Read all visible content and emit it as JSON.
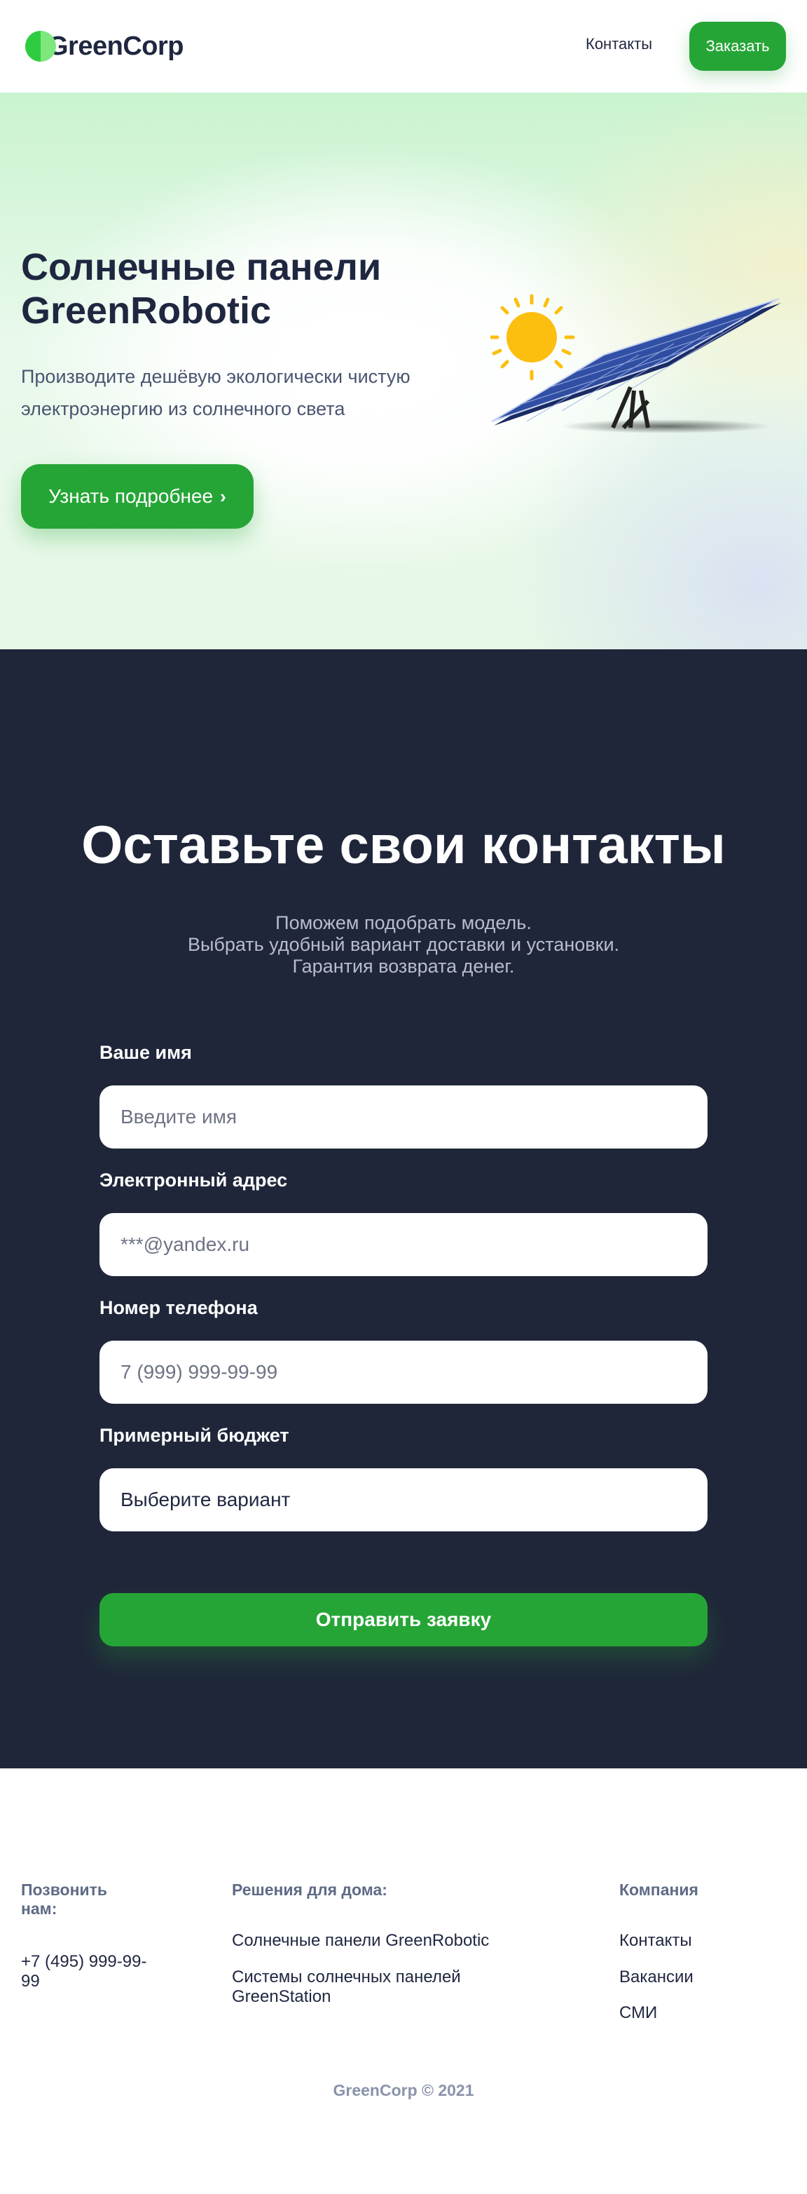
{
  "header": {
    "logo_text": "GreenCorp",
    "nav": {
      "contacts": "Контакты"
    },
    "order_button": "Заказать"
  },
  "hero": {
    "title_line1": "Солнечные панели",
    "title_line2": "GreenRobotic",
    "subtitle_line1": "Производите дешёвую экологически чистую",
    "subtitle_line2": "электроэнергию из солнечного света",
    "more_button": "Узнать подробнее",
    "more_button_icon": "chevron-right-icon"
  },
  "contact": {
    "title": "Оставьте свои контакты",
    "subtitle_lines": [
      "Поможем подобрать модель.",
      "Выбрать удобный вариант доставки и установки.",
      "Гарантия возврата денег."
    ],
    "fields": {
      "name": {
        "label": "Ваше имя",
        "placeholder": "Введите имя"
      },
      "email": {
        "label": "Электронный адрес",
        "placeholder": "***@yandex.ru"
      },
      "phone": {
        "label": "Номер телефона",
        "placeholder": "7 (999) 999-99-99"
      },
      "budget": {
        "label": "Примерный бюджет",
        "value": "Выберите вариант"
      }
    },
    "submit_button": "Отправить заявку"
  },
  "footer": {
    "call": {
      "heading_line1": "Позвонить",
      "heading_line2": "нам:",
      "phone_line1": "+7 (495) 999-99-",
      "phone_line2": "99"
    },
    "home": {
      "heading": "Решения для дома:",
      "item1": "Солнечные панели GreenRobotic",
      "item2_line1": "Системы солнечных панелей",
      "item2_line2": "GreenStation"
    },
    "company": {
      "heading": "Компания",
      "items": [
        "Контакты",
        "Вакансии",
        "СМИ"
      ]
    },
    "copyright": "GreenCorp © 2021"
  },
  "colors": {
    "brand_green": "#26a537",
    "dark_navy": "#1f2639",
    "text_dark": "#1f2740",
    "sun_yellow": "#fcbf0f",
    "panel_blue": "#2f4fa8"
  }
}
